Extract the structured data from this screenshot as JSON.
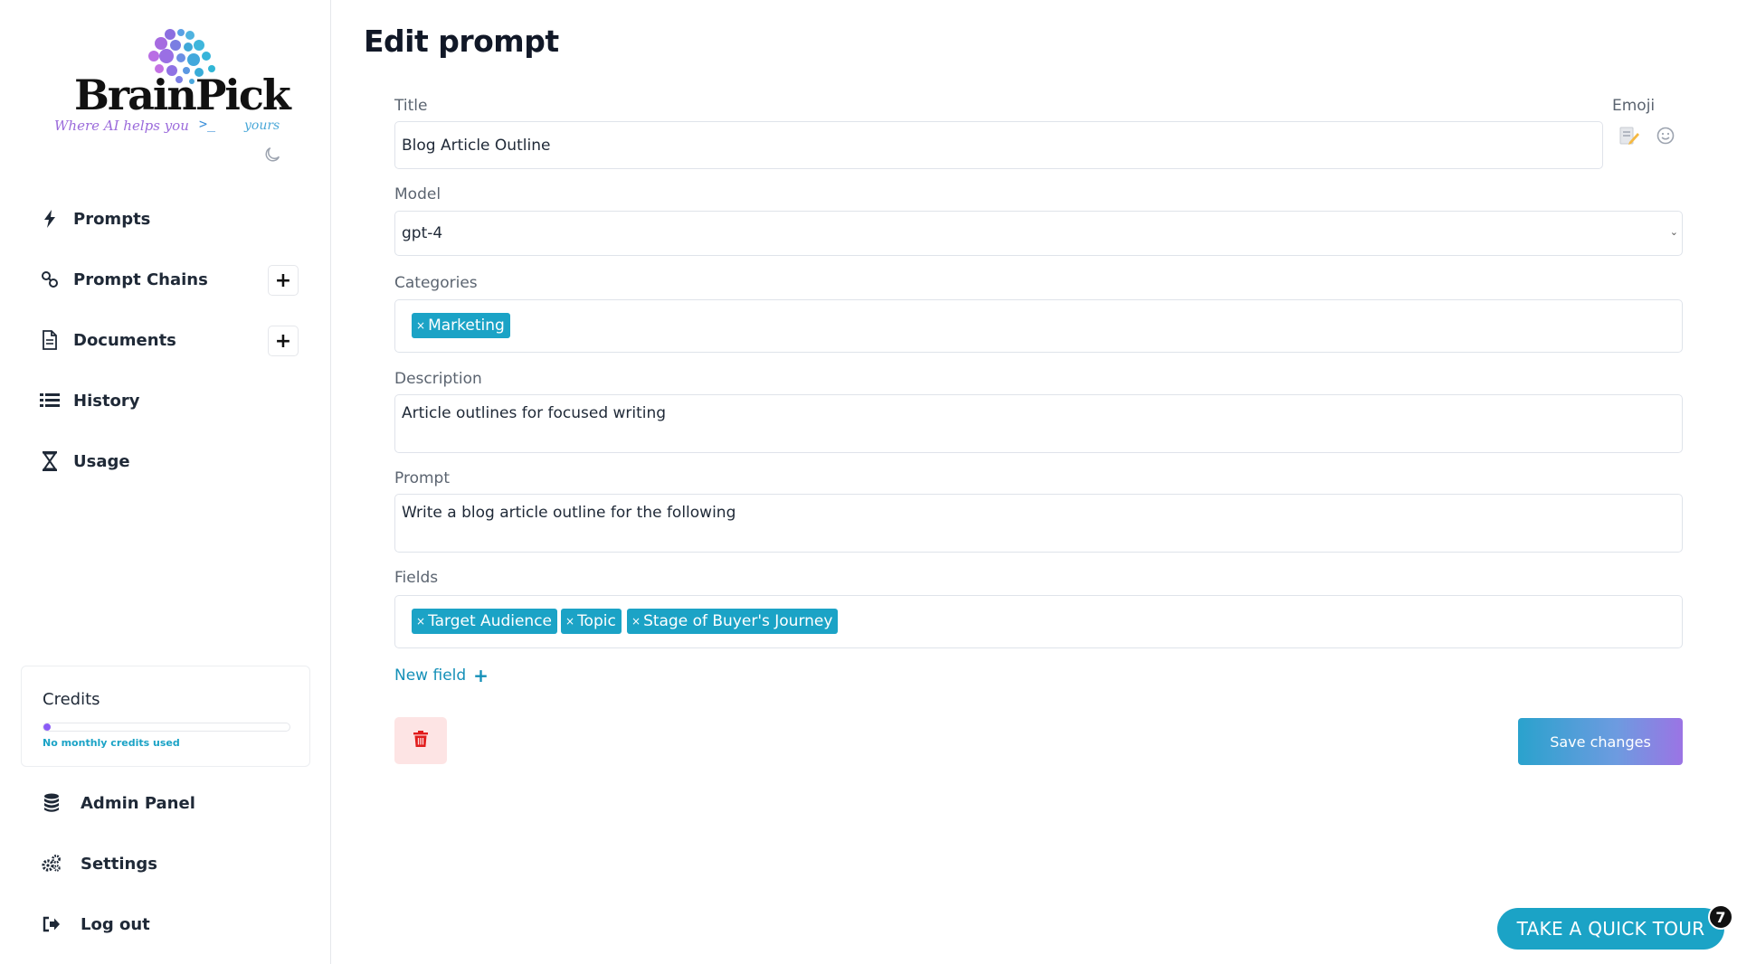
{
  "brand": {
    "name": "BrainPick",
    "tagline_left": "Where AI helps you",
    "tagline_prompt": ">_",
    "tagline_right": "yours"
  },
  "sidebar": {
    "items": [
      {
        "label": "Prompts",
        "icon": "bolt-icon"
      },
      {
        "label": "Prompt Chains",
        "icon": "link-icon",
        "add_button": "+"
      },
      {
        "label": "Documents",
        "icon": "document-icon",
        "add_button": "+"
      },
      {
        "label": "History",
        "icon": "list-icon"
      },
      {
        "label": "Usage",
        "icon": "hourglass-icon"
      }
    ],
    "credits": {
      "title": "Credits",
      "note": "No monthly credits used",
      "used_fraction": 0.0
    },
    "bottom_items": [
      {
        "label": "Admin Panel",
        "icon": "database-icon"
      },
      {
        "label": "Settings",
        "icon": "gears-icon"
      },
      {
        "label": "Log out",
        "icon": "logout-icon"
      }
    ]
  },
  "main": {
    "page_title": "Edit prompt",
    "title_label": "Title",
    "title_value": "Blog Article Outline",
    "emoji_label": "Emoji",
    "model_label": "Model",
    "model_value": "gpt-4",
    "categories_label": "Categories",
    "categories": [
      "Marketing"
    ],
    "description_label": "Description",
    "description_value": "Article outlines for focused writing",
    "prompt_label": "Prompt",
    "prompt_value": "Write a blog article outline for the following",
    "fields_label": "Fields",
    "fields": [
      "Target Audience",
      "Topic",
      "Stage of Buyer's Journey"
    ],
    "tag_remove": "×",
    "new_field": "New field",
    "new_field_plus": "+",
    "save_button": "Save changes"
  },
  "tour": {
    "label": "TAKE A QUICK TOUR",
    "badge": "7"
  },
  "colors": {
    "accent": "#1ba3c6",
    "purple": "#8b5cf6",
    "danger": "#e11d1d",
    "danger_bg": "#fde4e4"
  }
}
